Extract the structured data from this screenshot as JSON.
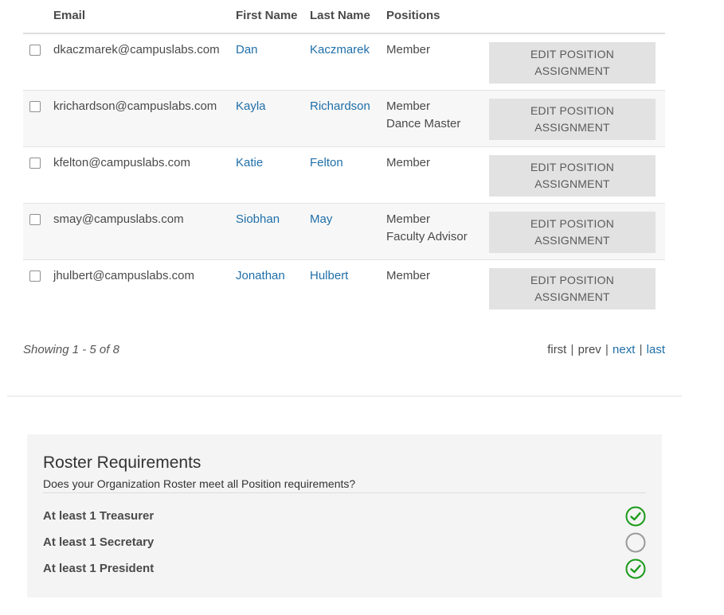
{
  "table": {
    "headers": {
      "email": "Email",
      "first": "First Name",
      "last": "Last Name",
      "positions": "Positions"
    },
    "rows": [
      {
        "email": "dkaczmarek@campuslabs.com",
        "first": "Dan",
        "last": "Kaczmarek",
        "positions": [
          "Member"
        ],
        "action": "EDIT POSITION ASSIGNMENT"
      },
      {
        "email": "krichardson@campuslabs.com",
        "first": "Kayla",
        "last": "Richardson",
        "positions": [
          "Member",
          "Dance Master"
        ],
        "action": "EDIT POSITION ASSIGNMENT"
      },
      {
        "email": "kfelton@campuslabs.com",
        "first": "Katie",
        "last": "Felton",
        "positions": [
          "Member"
        ],
        "action": "EDIT POSITION ASSIGNMENT"
      },
      {
        "email": "smay@campuslabs.com",
        "first": "Siobhan",
        "last": "May",
        "positions": [
          "Member",
          "Faculty Advisor"
        ],
        "action": "EDIT POSITION ASSIGNMENT"
      },
      {
        "email": "jhulbert@campuslabs.com",
        "first": "Jonathan",
        "last": "Hulbert",
        "positions": [
          "Member"
        ],
        "action": "EDIT POSITION ASSIGNMENT"
      }
    ]
  },
  "pagination": {
    "showing": "Showing 1 - 5 of 8",
    "first": "first",
    "prev": "prev",
    "next": "next",
    "last": "last",
    "separator": "|"
  },
  "requirements": {
    "title": "Roster Requirements",
    "subtitle": "Does your Organization Roster meet all Position requirements?",
    "items": [
      {
        "label": "At least 1 Treasurer",
        "met": true,
        "icon": "check-circle-icon"
      },
      {
        "label": "At least 1 Secretary",
        "met": false,
        "icon": "empty-circle-icon"
      },
      {
        "label": "At least 1 President",
        "met": true,
        "icon": "check-circle-icon"
      }
    ]
  },
  "colors": {
    "link": "#1f6fa8",
    "met": "#1a9a1a",
    "unmet": "#9a9a9a",
    "button_bg": "#e2e2e2",
    "panel_bg": "#f4f4f4"
  }
}
